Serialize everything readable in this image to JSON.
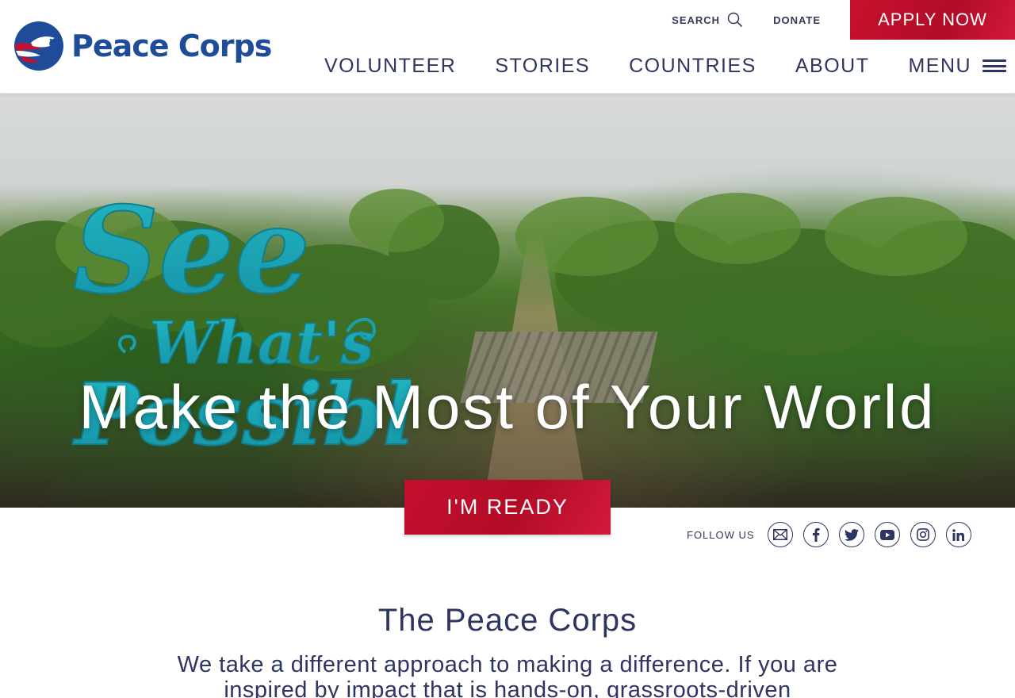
{
  "brand": {
    "name": "Peace Corps",
    "primary_color": "#1f4c98",
    "accent_color": "#c8102e",
    "logo_icon": "dove-flag-logo-icon"
  },
  "utility_nav": {
    "search_label": "SEARCH",
    "search_icon": "search-icon",
    "donate_label": "DONATE",
    "apply_label": "APPLY NOW"
  },
  "main_nav": {
    "items": [
      {
        "label": "VOLUNTEER"
      },
      {
        "label": "STORIES"
      },
      {
        "label": "COUNTRIES"
      },
      {
        "label": "ABOUT"
      }
    ],
    "menu_label": "MENU",
    "menu_icon": "hamburger-icon"
  },
  "hero": {
    "script_line1": "See",
    "script_line2": "What's",
    "script_line3": "Possible",
    "title": "Make the Most of Your World",
    "cta_label": "I'M READY"
  },
  "follow": {
    "label": "FOLLOW US",
    "icons": [
      "email-icon",
      "facebook-icon",
      "twitter-icon",
      "youtube-icon",
      "instagram-icon",
      "linkedin-icon"
    ]
  },
  "intro": {
    "title": "The Peace Corps",
    "text": "We take a different approach to making a difference. If you are inspired by impact that is hands-on, grassroots-driven"
  }
}
